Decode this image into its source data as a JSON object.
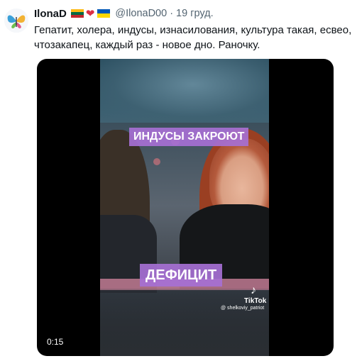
{
  "tweet": {
    "display_name": "IlonaD",
    "handle": "@IlonaD00",
    "separator": "·",
    "date": "19 груд.",
    "text": "Гепатит, холера, индусы, изнасилования, культура такая, есвео, чтозакапец, каждый раз - новое дно. Раночку."
  },
  "badges": {
    "flag_1": "lithuania-flag-icon",
    "heart": "❤",
    "flag_2": "ukraine-flag-icon"
  },
  "media": {
    "caption_top": "ИНДУСЫ ЗАКРОЮТ",
    "caption_bottom": "ДЕФИЦИТ",
    "watermark_brand": "TikTok",
    "watermark_user": "@ shelkoviy_patriot",
    "timestamp": "0:15"
  },
  "colors": {
    "text": "#0f1419",
    "secondary_text": "#536471",
    "caption_background": "#a670d4",
    "heart": "#dd2e44"
  }
}
